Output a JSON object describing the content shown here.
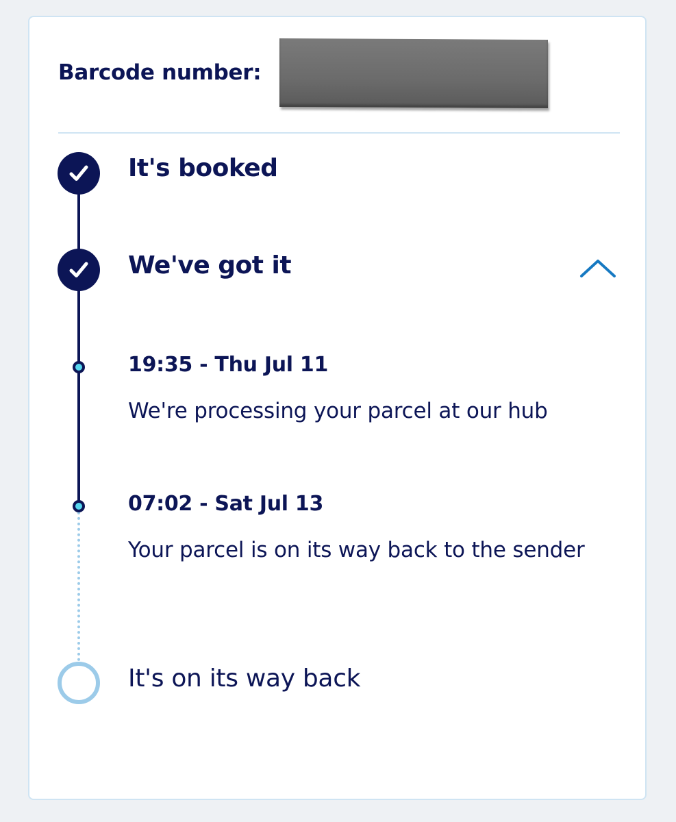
{
  "barcode": {
    "label": "Barcode number:"
  },
  "tracking": {
    "steps": [
      {
        "title": "It's booked",
        "status": "complete",
        "icon": "check-icon"
      },
      {
        "title": "We've got it",
        "status": "complete",
        "icon": "check-icon",
        "expanded": true,
        "toggle_icon": "chevron-up-icon"
      },
      {
        "title": "It's on its way back",
        "status": "pending"
      }
    ],
    "events": [
      {
        "time": "19:35 - Thu Jul 11",
        "description": "We're processing your parcel at our hub"
      },
      {
        "time": "07:02 - Sat Jul 13",
        "description": "Your parcel is on its way back to the sender"
      }
    ]
  },
  "colors": {
    "navy": "#0c1556",
    "accent_blue": "#1679c2",
    "light_blue": "#9ccbe9",
    "event_dot": "#57d6ef",
    "page_bg": "#eef1f4"
  }
}
